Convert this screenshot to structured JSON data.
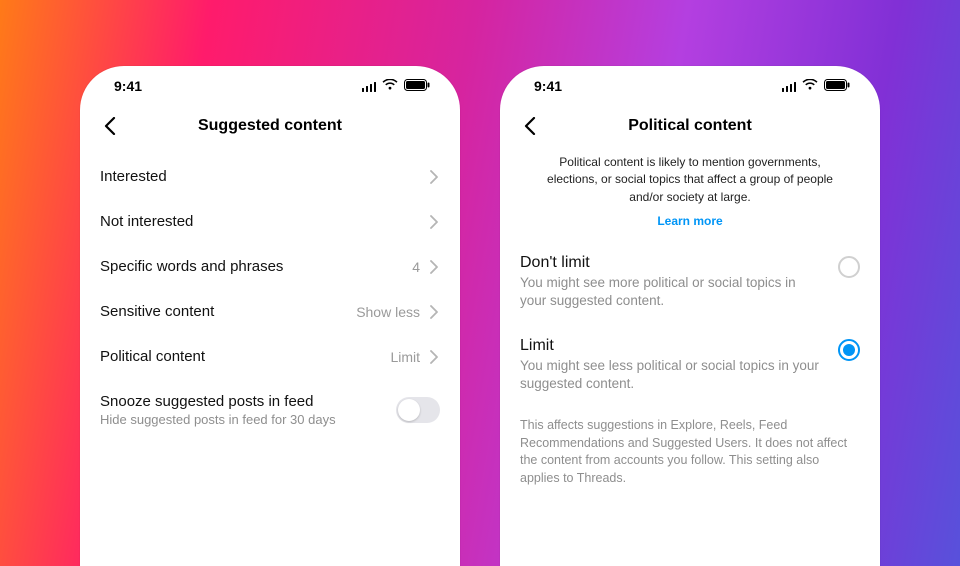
{
  "status": {
    "time": "9:41"
  },
  "left": {
    "title": "Suggested content",
    "rows": [
      {
        "label": "Interested",
        "value": ""
      },
      {
        "label": "Not interested",
        "value": ""
      },
      {
        "label": "Specific words and phrases",
        "value": "4"
      },
      {
        "label": "Sensitive content",
        "value": "Show less"
      },
      {
        "label": "Political content",
        "value": "Limit"
      }
    ],
    "snooze": {
      "label": "Snooze suggested posts in feed",
      "sub": "Hide suggested posts in feed for 30 days",
      "on": false
    }
  },
  "right": {
    "title": "Political content",
    "description": "Political content is likely to mention governments, elections, or social topics that affect a group of people and/or society at large.",
    "learn_more": "Learn more",
    "options": [
      {
        "title": "Don't limit",
        "sub": "You might see more political or social topics in your suggested content.",
        "selected": false
      },
      {
        "title": "Limit",
        "sub": "You might see less political or social topics in your suggested content.",
        "selected": true
      }
    ],
    "footnote": "This affects suggestions in Explore, Reels, Feed Recommendations and Suggested Users. It does not affect the content from accounts you follow. This setting also applies to Threads."
  }
}
